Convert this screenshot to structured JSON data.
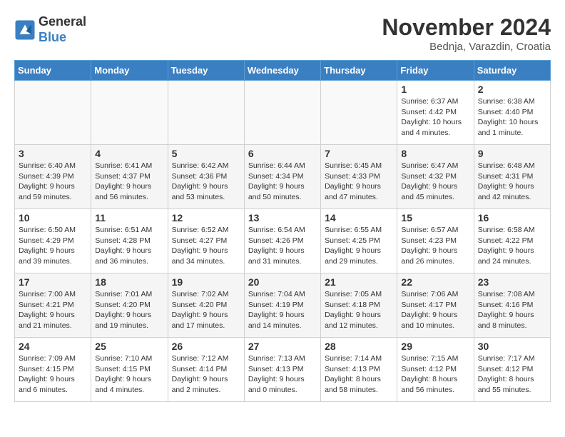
{
  "logo": {
    "general": "General",
    "blue": "Blue"
  },
  "title": "November 2024",
  "location": "Bednja, Varazdin, Croatia",
  "weekdays": [
    "Sunday",
    "Monday",
    "Tuesday",
    "Wednesday",
    "Thursday",
    "Friday",
    "Saturday"
  ],
  "weeks": [
    [
      {
        "day": "",
        "info": ""
      },
      {
        "day": "",
        "info": ""
      },
      {
        "day": "",
        "info": ""
      },
      {
        "day": "",
        "info": ""
      },
      {
        "day": "",
        "info": ""
      },
      {
        "day": "1",
        "info": "Sunrise: 6:37 AM\nSunset: 4:42 PM\nDaylight: 10 hours\nand 4 minutes."
      },
      {
        "day": "2",
        "info": "Sunrise: 6:38 AM\nSunset: 4:40 PM\nDaylight: 10 hours\nand 1 minute."
      }
    ],
    [
      {
        "day": "3",
        "info": "Sunrise: 6:40 AM\nSunset: 4:39 PM\nDaylight: 9 hours\nand 59 minutes."
      },
      {
        "day": "4",
        "info": "Sunrise: 6:41 AM\nSunset: 4:37 PM\nDaylight: 9 hours\nand 56 minutes."
      },
      {
        "day": "5",
        "info": "Sunrise: 6:42 AM\nSunset: 4:36 PM\nDaylight: 9 hours\nand 53 minutes."
      },
      {
        "day": "6",
        "info": "Sunrise: 6:44 AM\nSunset: 4:34 PM\nDaylight: 9 hours\nand 50 minutes."
      },
      {
        "day": "7",
        "info": "Sunrise: 6:45 AM\nSunset: 4:33 PM\nDaylight: 9 hours\nand 47 minutes."
      },
      {
        "day": "8",
        "info": "Sunrise: 6:47 AM\nSunset: 4:32 PM\nDaylight: 9 hours\nand 45 minutes."
      },
      {
        "day": "9",
        "info": "Sunrise: 6:48 AM\nSunset: 4:31 PM\nDaylight: 9 hours\nand 42 minutes."
      }
    ],
    [
      {
        "day": "10",
        "info": "Sunrise: 6:50 AM\nSunset: 4:29 PM\nDaylight: 9 hours\nand 39 minutes."
      },
      {
        "day": "11",
        "info": "Sunrise: 6:51 AM\nSunset: 4:28 PM\nDaylight: 9 hours\nand 36 minutes."
      },
      {
        "day": "12",
        "info": "Sunrise: 6:52 AM\nSunset: 4:27 PM\nDaylight: 9 hours\nand 34 minutes."
      },
      {
        "day": "13",
        "info": "Sunrise: 6:54 AM\nSunset: 4:26 PM\nDaylight: 9 hours\nand 31 minutes."
      },
      {
        "day": "14",
        "info": "Sunrise: 6:55 AM\nSunset: 4:25 PM\nDaylight: 9 hours\nand 29 minutes."
      },
      {
        "day": "15",
        "info": "Sunrise: 6:57 AM\nSunset: 4:23 PM\nDaylight: 9 hours\nand 26 minutes."
      },
      {
        "day": "16",
        "info": "Sunrise: 6:58 AM\nSunset: 4:22 PM\nDaylight: 9 hours\nand 24 minutes."
      }
    ],
    [
      {
        "day": "17",
        "info": "Sunrise: 7:00 AM\nSunset: 4:21 PM\nDaylight: 9 hours\nand 21 minutes."
      },
      {
        "day": "18",
        "info": "Sunrise: 7:01 AM\nSunset: 4:20 PM\nDaylight: 9 hours\nand 19 minutes."
      },
      {
        "day": "19",
        "info": "Sunrise: 7:02 AM\nSunset: 4:20 PM\nDaylight: 9 hours\nand 17 minutes."
      },
      {
        "day": "20",
        "info": "Sunrise: 7:04 AM\nSunset: 4:19 PM\nDaylight: 9 hours\nand 14 minutes."
      },
      {
        "day": "21",
        "info": "Sunrise: 7:05 AM\nSunset: 4:18 PM\nDaylight: 9 hours\nand 12 minutes."
      },
      {
        "day": "22",
        "info": "Sunrise: 7:06 AM\nSunset: 4:17 PM\nDaylight: 9 hours\nand 10 minutes."
      },
      {
        "day": "23",
        "info": "Sunrise: 7:08 AM\nSunset: 4:16 PM\nDaylight: 9 hours\nand 8 minutes."
      }
    ],
    [
      {
        "day": "24",
        "info": "Sunrise: 7:09 AM\nSunset: 4:15 PM\nDaylight: 9 hours\nand 6 minutes."
      },
      {
        "day": "25",
        "info": "Sunrise: 7:10 AM\nSunset: 4:15 PM\nDaylight: 9 hours\nand 4 minutes."
      },
      {
        "day": "26",
        "info": "Sunrise: 7:12 AM\nSunset: 4:14 PM\nDaylight: 9 hours\nand 2 minutes."
      },
      {
        "day": "27",
        "info": "Sunrise: 7:13 AM\nSunset: 4:13 PM\nDaylight: 9 hours\nand 0 minutes."
      },
      {
        "day": "28",
        "info": "Sunrise: 7:14 AM\nSunset: 4:13 PM\nDaylight: 8 hours\nand 58 minutes."
      },
      {
        "day": "29",
        "info": "Sunrise: 7:15 AM\nSunset: 4:12 PM\nDaylight: 8 hours\nand 56 minutes."
      },
      {
        "day": "30",
        "info": "Sunrise: 7:17 AM\nSunset: 4:12 PM\nDaylight: 8 hours\nand 55 minutes."
      }
    ]
  ]
}
